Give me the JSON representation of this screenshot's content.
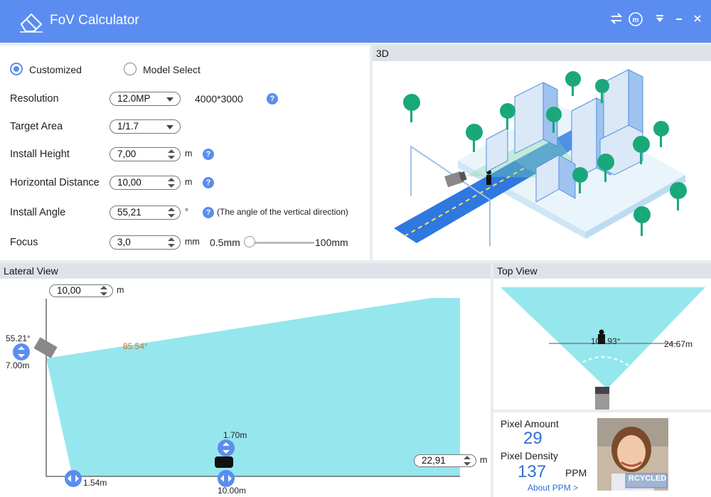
{
  "app": {
    "title": "FoV Calculator"
  },
  "mode": {
    "customized_label": "Customized",
    "model_select_label": "Model Select",
    "selected": "Customized"
  },
  "form": {
    "resolution": {
      "label": "Resolution",
      "value": "12.0MP",
      "dimensions": "4000*3000"
    },
    "target_area": {
      "label": "Target Area",
      "value": "1/1.7"
    },
    "install_height": {
      "label": "Install Height",
      "value": "7,00",
      "unit": "m"
    },
    "horizontal_distance": {
      "label": "Horizontal Distance",
      "value": "10,00",
      "unit": "m"
    },
    "install_angle": {
      "label": "Install Angle",
      "value": "55,21",
      "unit": "°",
      "note": "(The angle of the vertical direction)"
    },
    "focus": {
      "label": "Focus",
      "value": "3,0",
      "unit": "mm",
      "min_label": "0.5mm",
      "max_label": "100mm",
      "slider_fraction": 0.0
    }
  },
  "view3d": {
    "title": "3D"
  },
  "lateral": {
    "title": "Lateral View",
    "top_height_value": "10,00",
    "top_height_unit": "m",
    "angle_label": "55.21°",
    "height_label": "7.00m",
    "fov_label": "85.54°",
    "near_label": "1.54m",
    "target_height_label": "1.70m",
    "target_distance_label": "10.00m",
    "far_value": "22,91",
    "far_unit": "m"
  },
  "top_view": {
    "title": "Top View",
    "angle_label": "102.93°",
    "width_label": "24.67m"
  },
  "pixel": {
    "amount_label": "Pixel Amount",
    "amount_value": "29",
    "density_label": "Pixel Density",
    "density_value": "137",
    "density_unit": "PPM",
    "about_link": "About PPM >",
    "plate_text": "RCYCLED"
  },
  "colors": {
    "accent": "#5b8df1",
    "fov": "#96e6ee",
    "titlebar": "#5b8df1"
  }
}
